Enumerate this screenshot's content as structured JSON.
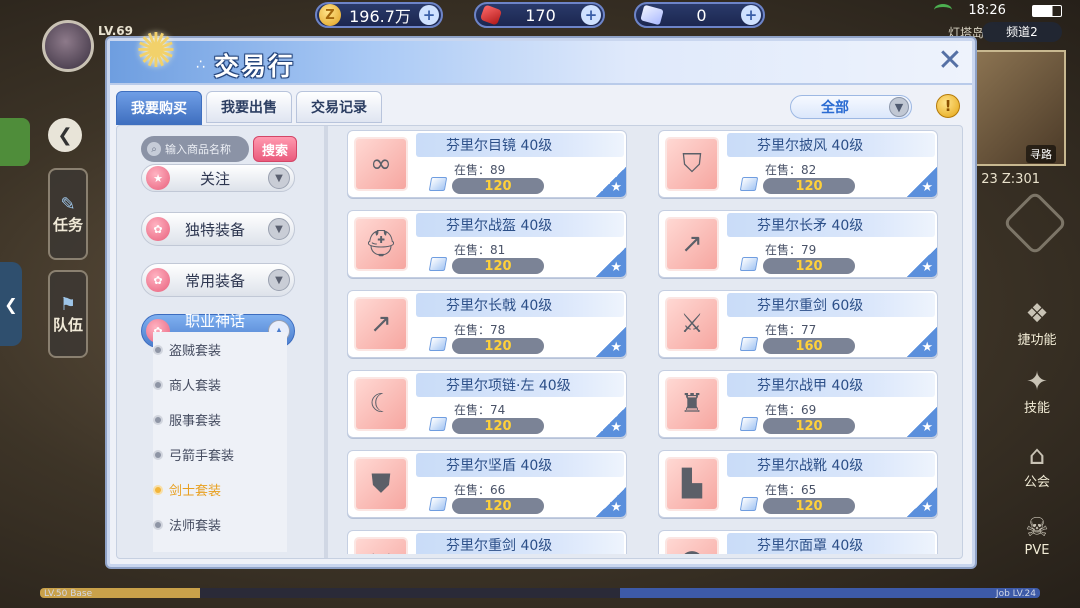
{
  "status_bar": {
    "time": "18:26",
    "region": "灯塔岛",
    "channel": "频道2"
  },
  "hud": {
    "level": "LV.69",
    "side_buttons": [
      "任务",
      "队伍"
    ],
    "right_items": [
      "捷功能",
      "技能",
      "公会",
      "PVE"
    ],
    "minimap_label": "寻路",
    "coords": "23  Z:301",
    "base_left": "LV.50 Base",
    "base_right": "Job LV.24"
  },
  "currencies": [
    {
      "name": "zeny",
      "icon": "coin-icon",
      "value": "196.7万"
    },
    {
      "name": "ruby",
      "icon": "ruby-icon",
      "value": "170"
    },
    {
      "name": "diamond",
      "icon": "diamond-icon",
      "value": "0"
    }
  ],
  "dialog": {
    "title": "交易行",
    "tabs": [
      {
        "label": "我要购买",
        "active": true
      },
      {
        "label": "我要出售",
        "active": false
      },
      {
        "label": "交易记录",
        "active": false
      }
    ],
    "filter": "全部",
    "help": "!"
  },
  "sidebar": {
    "search_placeholder": "输入商品名称",
    "search_button": "搜索",
    "categories": [
      {
        "label": "关注",
        "expanded": false
      },
      {
        "label": "独特装备",
        "expanded": false
      },
      {
        "label": "常用装备",
        "expanded": false
      },
      {
        "label": "职业神话套",
        "expanded": true
      }
    ],
    "sub_items": [
      {
        "label": "盗贼套装",
        "active": false
      },
      {
        "label": "商人套装",
        "active": false
      },
      {
        "label": "服事套装",
        "active": false
      },
      {
        "label": "弓箭手套装",
        "active": false
      },
      {
        "label": "剑士套装",
        "active": true
      },
      {
        "label": "法师套装",
        "active": false
      }
    ]
  },
  "stock_label": "在售：",
  "items": [
    {
      "name": "芬里尔目镜 40级",
      "stock": "89",
      "price": "120",
      "icon": "glasses-icon"
    },
    {
      "name": "芬里尔披风 40级",
      "stock": "82",
      "price": "120",
      "icon": "cape-icon"
    },
    {
      "name": "芬里尔战盔 40级",
      "stock": "81",
      "price": "120",
      "icon": "helmet-icon"
    },
    {
      "name": "芬里尔长矛 40级",
      "stock": "79",
      "price": "120",
      "icon": "spear-icon"
    },
    {
      "name": "芬里尔长戟 40级",
      "stock": "78",
      "price": "120",
      "icon": "halberd-icon"
    },
    {
      "name": "芬里尔重剑 60级",
      "stock": "77",
      "price": "160",
      "icon": "sword-icon"
    },
    {
      "name": "芬里尔项链·左 40级",
      "stock": "74",
      "price": "120",
      "icon": "necklace-icon"
    },
    {
      "name": "芬里尔战甲 40级",
      "stock": "69",
      "price": "120",
      "icon": "armor-icon"
    },
    {
      "name": "芬里尔坚盾 40级",
      "stock": "66",
      "price": "120",
      "icon": "shield-icon"
    },
    {
      "name": "芬里尔战靴 40级",
      "stock": "65",
      "price": "120",
      "icon": "boots-icon"
    },
    {
      "name": "芬里尔重剑 40级",
      "stock": "",
      "price": "",
      "icon": "sword-icon"
    },
    {
      "name": "芬里尔面罩 40级",
      "stock": "",
      "price": "",
      "icon": "mask-icon"
    }
  ]
}
